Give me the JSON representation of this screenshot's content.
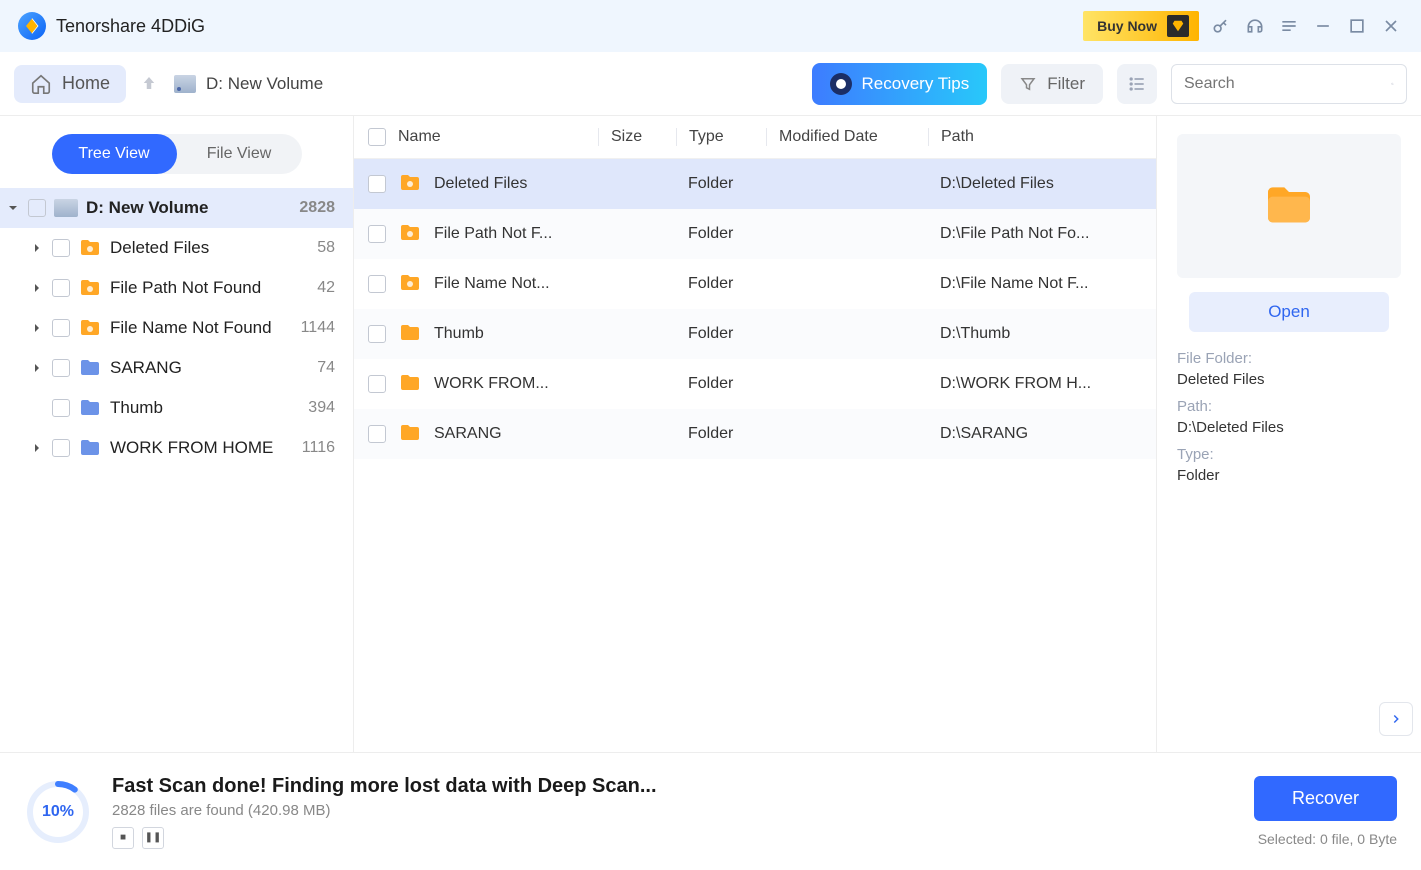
{
  "app": {
    "title": "Tenorshare 4DDiG"
  },
  "titlebar": {
    "buy": "Buy Now"
  },
  "toolbar": {
    "home": "Home",
    "drive": "D: New Volume",
    "tips": "Recovery Tips",
    "filter": "Filter",
    "search_placeholder": "Search"
  },
  "views": {
    "tree": "Tree View",
    "file": "File View"
  },
  "tree": {
    "root": {
      "label": "D: New Volume",
      "count": "2828"
    },
    "items": [
      {
        "label": "Deleted Files",
        "count": "58",
        "icon": "orange-special",
        "expandable": true
      },
      {
        "label": "File Path Not Found",
        "count": "42",
        "icon": "orange-special",
        "expandable": true
      },
      {
        "label": "File Name Not Found",
        "count": "1144",
        "icon": "orange-special",
        "expandable": true
      },
      {
        "label": "SARANG",
        "count": "74",
        "icon": "blue",
        "expandable": true
      },
      {
        "label": "Thumb",
        "count": "394",
        "icon": "blue",
        "expandable": false
      },
      {
        "label": "WORK FROM HOME",
        "count": "1116",
        "icon": "blue",
        "expandable": true
      }
    ]
  },
  "columns": {
    "name": "Name",
    "size": "Size",
    "type": "Type",
    "date": "Modified Date",
    "path": "Path"
  },
  "rows": [
    {
      "name": "Deleted Files",
      "type": "Folder",
      "path": "D:\\Deleted Files",
      "icon": "orange-special",
      "selected": true
    },
    {
      "name": "File Path Not F...",
      "type": "Folder",
      "path": "D:\\File Path Not Fo...",
      "icon": "orange-special"
    },
    {
      "name": "File Name Not...",
      "type": "Folder",
      "path": "D:\\File Name Not F...",
      "icon": "orange-special"
    },
    {
      "name": "Thumb",
      "type": "Folder",
      "path": "D:\\Thumb",
      "icon": "orange-plain"
    },
    {
      "name": "WORK FROM...",
      "type": "Folder",
      "path": "D:\\WORK FROM H...",
      "icon": "orange-plain"
    },
    {
      "name": "SARANG",
      "type": "Folder",
      "path": "D:\\SARANG",
      "icon": "orange-plain"
    }
  ],
  "preview": {
    "open": "Open",
    "folder_label": "File Folder:",
    "folder_val": "Deleted Files",
    "path_label": "Path:",
    "path_val": "D:\\Deleted Files",
    "type_label": "Type:",
    "type_val": "Folder"
  },
  "footer": {
    "pct": "10%",
    "title": "Fast Scan done! Finding more lost data with Deep Scan...",
    "sub": "2828 files are found (420.98 MB)",
    "recover": "Recover",
    "selected": "Selected: 0 file, 0 Byte"
  }
}
